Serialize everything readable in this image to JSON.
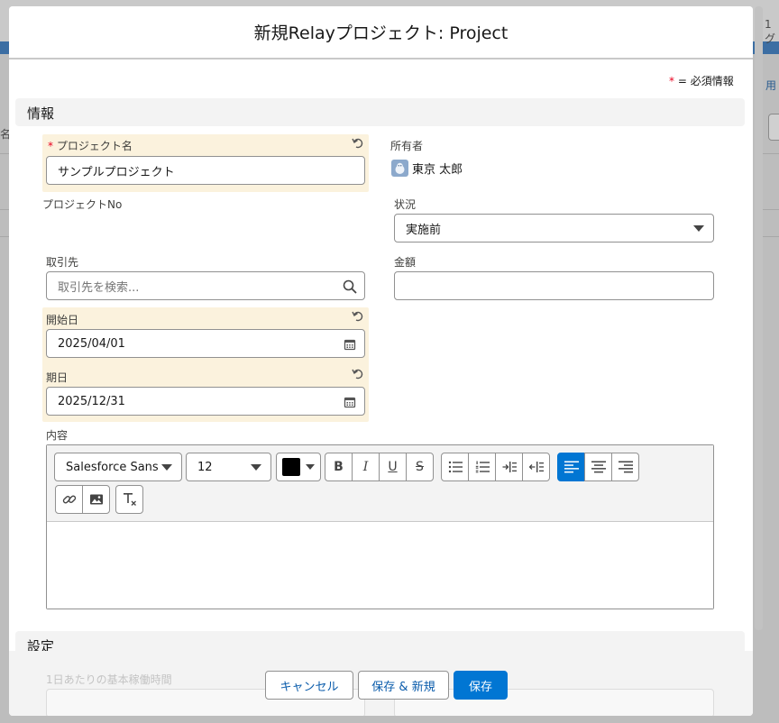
{
  "background": {
    "right_edge_text_1": "1グ",
    "right_edge_text_2": "用",
    "left_edge_text": "名"
  },
  "modal": {
    "title": "新規Relayプロジェクト: Project",
    "required_legend_star": "*",
    "required_legend_text": "= 必須情報"
  },
  "sections": {
    "info": "情報",
    "settings": "設定"
  },
  "fields": {
    "project_name": {
      "required_star": "*",
      "label": "プロジェクト名",
      "value": "サンプルプロジェクト"
    },
    "owner": {
      "label": "所有者",
      "value": "東京 太郎"
    },
    "project_no": {
      "label": "プロジェクトNo"
    },
    "status": {
      "label": "状況",
      "value": "実施前"
    },
    "account": {
      "label": "取引先",
      "placeholder": "取引先を検索..."
    },
    "amount": {
      "label": "金額",
      "value": ""
    },
    "start_date": {
      "label": "開始日",
      "value": "2025/04/01"
    },
    "due_date": {
      "label": "期日",
      "value": "2025/12/31"
    },
    "content": {
      "label": "内容"
    }
  },
  "editor": {
    "font_family": "Salesforce Sans",
    "font_size": "12",
    "text_color": "#000000",
    "active_align": "left"
  },
  "settings_section": {
    "faded_label": "1日あたりの基本稼働時間"
  },
  "footer": {
    "cancel": "キャンセル",
    "save_new": "保存 & 新規",
    "save": "保存"
  },
  "colors": {
    "brand": "#0176d3",
    "required": "#ea001e",
    "highlight": "#fbf2dd"
  }
}
